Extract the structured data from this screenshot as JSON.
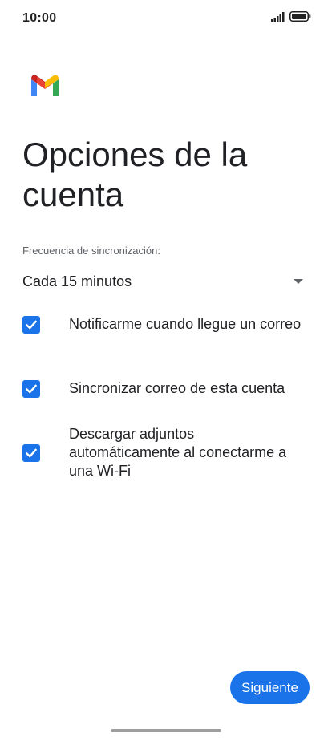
{
  "status_bar": {
    "time": "10:00",
    "icons": [
      "signal-icon",
      "battery-icon"
    ]
  },
  "app": {
    "logo": "gmail-logo",
    "colors": {
      "accent": "#1a73e8",
      "gmail_red": "#ea4335",
      "gmail_blue": "#4285f4",
      "gmail_green": "#34a853",
      "gmail_yellow": "#fbbc04"
    }
  },
  "page": {
    "title": "Opciones de la cuenta"
  },
  "sync": {
    "label": "Frecuencia de sincronización:",
    "selected": "Cada 15 minutos"
  },
  "options": [
    {
      "label": "Notificarme cuando llegue un correo",
      "checked": true
    },
    {
      "label": "Sincronizar correo de esta cuenta",
      "checked": true
    },
    {
      "label": "Descargar adjuntos automáticamente al conectarme a una Wi-Fi",
      "checked": true
    }
  ],
  "actions": {
    "next_label": "Siguiente"
  }
}
